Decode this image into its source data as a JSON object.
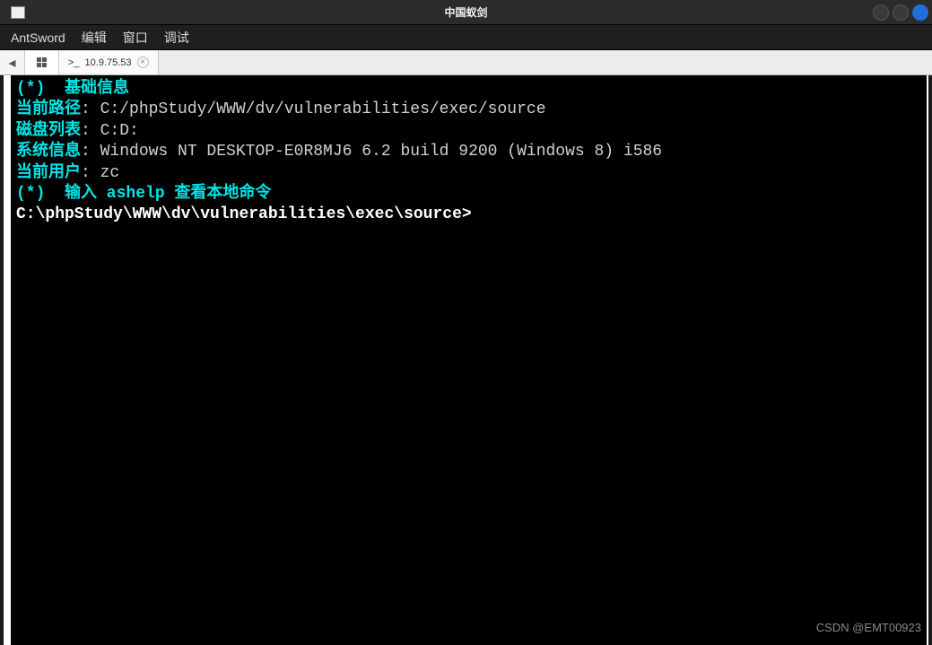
{
  "window": {
    "title": "中国蚁剑"
  },
  "menubar": {
    "app": "AntSword",
    "edit": "编辑",
    "window": "窗口",
    "debug": "调试"
  },
  "tabs": {
    "nav_prev": "◂",
    "active": {
      "icon": ">_",
      "label": "10.9.75.53",
      "close": "×"
    }
  },
  "terminal": {
    "header": "(*)  基础信息",
    "path_label": "当前路径",
    "path_value": "C:/phpStudy/WWW/dv/vulnerabilities/exec/source",
    "disk_label": "磁盘列表",
    "disk_value": "C:D:",
    "sys_label": "系统信息",
    "sys_value": "Windows NT DESKTOP-E0R8MJ6 6.2 build 9200 (Windows 8) i586",
    "user_label": "当前用户",
    "user_value": "zc",
    "help_line": "(*)  输入 ashelp 查看本地命令",
    "prompt": "C:\\phpStudy\\WWW\\dv\\vulnerabilities\\exec\\source>",
    "colon": ": "
  },
  "watermark": "CSDN @EMT00923"
}
